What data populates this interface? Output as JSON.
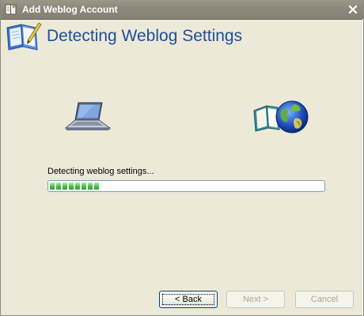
{
  "window": {
    "title": "Add Weblog Account"
  },
  "header": {
    "title": "Detecting Weblog Settings"
  },
  "progress": {
    "status_text": "Detecting weblog settings...",
    "blocks_filled": 8
  },
  "buttons": {
    "back_label": "< Back",
    "next_label": "Next >",
    "cancel_label": "Cancel"
  },
  "colors": {
    "header_title": "#1e4d9b",
    "progress_green": "#4ec34e",
    "dialog_background": "#ece9d8"
  },
  "icons": {
    "title": "weblog-book-icon",
    "header": "weblog-book-icon",
    "laptop": "laptop-icon",
    "globe": "globe-book-icon",
    "close": "close-icon"
  }
}
